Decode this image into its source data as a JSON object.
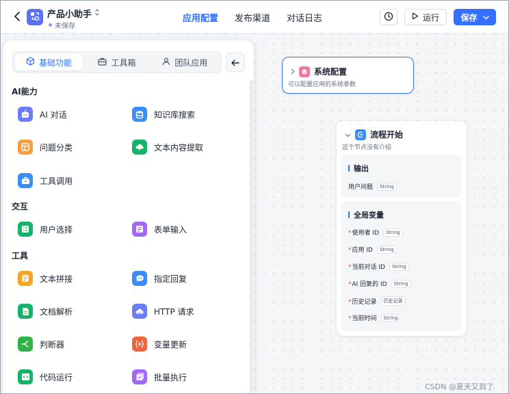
{
  "topbar": {
    "app_name": "产品小助手",
    "status": "未保存",
    "nav": [
      "应用配置",
      "发布渠道",
      "对话日志"
    ],
    "run_label": "运行",
    "save_label": "保存",
    "colors": {
      "accent": "#3370ff"
    }
  },
  "panel": {
    "tabs": [
      "基础功能",
      "工具箱",
      "团队应用"
    ],
    "sections": [
      {
        "title": "AI能力",
        "items": [
          {
            "label": "AI 对话",
            "icon": "robot-icon",
            "color": "#6b7cf7"
          },
          {
            "label": "知识库搜索",
            "icon": "database-icon",
            "color": "#3a8df5"
          },
          {
            "label": "问题分类",
            "icon": "layout-icon",
            "color": "#f59e42"
          },
          {
            "label": "文本内容提取",
            "icon": "cloud-icon",
            "color": "#17b26a"
          },
          {
            "label": "工具调用",
            "icon": "toolbox-icon",
            "color": "#3a8df5"
          }
        ]
      },
      {
        "title": "交互",
        "items": [
          {
            "label": "用户选择",
            "icon": "list-icon",
            "color": "#17b26a"
          },
          {
            "label": "表单输入",
            "icon": "form-icon",
            "color": "#a26af2"
          }
        ]
      },
      {
        "title": "工具",
        "items": [
          {
            "label": "文本拼接",
            "icon": "text-icon",
            "color": "#f5a524"
          },
          {
            "label": "指定回复",
            "icon": "chat-icon",
            "color": "#3a8df5"
          },
          {
            "label": "文档解析",
            "icon": "doc-icon",
            "color": "#17b26a"
          },
          {
            "label": "HTTP 请求",
            "icon": "http-icon",
            "color": "#6b7cf7"
          },
          {
            "label": "判断器",
            "icon": "branch-icon",
            "color": "#2fb344"
          },
          {
            "label": "变量更新",
            "icon": "variable-icon",
            "color": "#f0643c"
          },
          {
            "label": "代码运行",
            "icon": "code-icon",
            "color": "#17b26a"
          },
          {
            "label": "批量执行",
            "icon": "batch-icon",
            "color": "#a26af2"
          }
        ]
      }
    ]
  },
  "system_node": {
    "title": "系统配置",
    "desc": "可以配置应用的系统参数"
  },
  "start_node": {
    "title": "流程开始",
    "desc": "这个节点没有介绍",
    "output_title": "输出",
    "outputs": [
      {
        "name": "用户问题",
        "type": "String"
      }
    ],
    "globals_title": "全局变量",
    "globals": [
      {
        "name": "使用者 ID",
        "type": "String"
      },
      {
        "name": "应用 ID",
        "type": "String"
      },
      {
        "name": "当前对话 ID",
        "type": "String"
      },
      {
        "name": "AI 回复的 ID",
        "type": "String"
      },
      {
        "name": "历史记录",
        "type": "历史记录"
      },
      {
        "name": "当前时间",
        "type": "String"
      }
    ]
  },
  "watermark": "CSDN @夏天又到了"
}
